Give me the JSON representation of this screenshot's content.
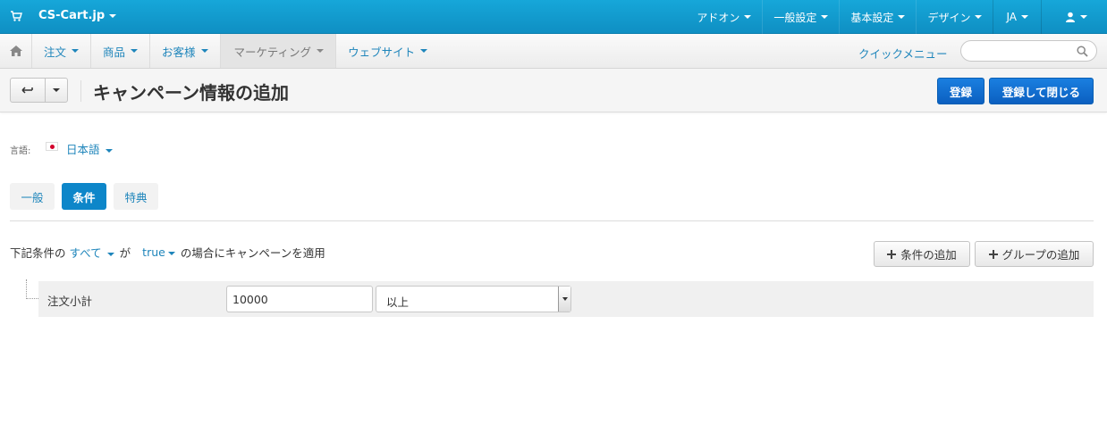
{
  "topbar": {
    "brand": "CS-Cart.jp",
    "menus": [
      {
        "label": "アドオン"
      },
      {
        "label": "一般設定"
      },
      {
        "label": "基本設定"
      },
      {
        "label": "デザイン"
      },
      {
        "label": "JA"
      }
    ],
    "user_icon": "user-icon",
    "cart_icon": "shopping-cart-icon"
  },
  "nav": {
    "home_icon": "home-icon",
    "items": [
      {
        "label": "注文"
      },
      {
        "label": "商品"
      },
      {
        "label": "お客様"
      },
      {
        "label": "マーケティング",
        "active": true
      },
      {
        "label": "ウェブサイト"
      }
    ],
    "quick_menu": "クイックメニュー",
    "search": {
      "value": "",
      "placeholder": ""
    }
  },
  "titlebar": {
    "title": "キャンペーン情報の追加",
    "save_label": "登録",
    "save_close_label": "登録して閉じる"
  },
  "language": {
    "label": "言語:",
    "value": "日本語"
  },
  "tabs": [
    {
      "label": "一般"
    },
    {
      "label": "条件",
      "active": true
    },
    {
      "label": "特典"
    }
  ],
  "conditions": {
    "sentence_prefix": "下記条件の",
    "set_value": "すべて",
    "sentence_mid": "が",
    "bool_value": "true",
    "sentence_suffix": "の場合にキャンペーンを適用",
    "add_condition_label": "条件の追加",
    "add_group_label": "グループの追加",
    "rows": [
      {
        "label": "注文小計",
        "value": "10000",
        "operator": "以上"
      }
    ]
  },
  "colors": {
    "topbar": "#1299cf",
    "link": "#1e85bb",
    "primary": "#0b5fc0",
    "active_tab": "#0d86c9"
  }
}
